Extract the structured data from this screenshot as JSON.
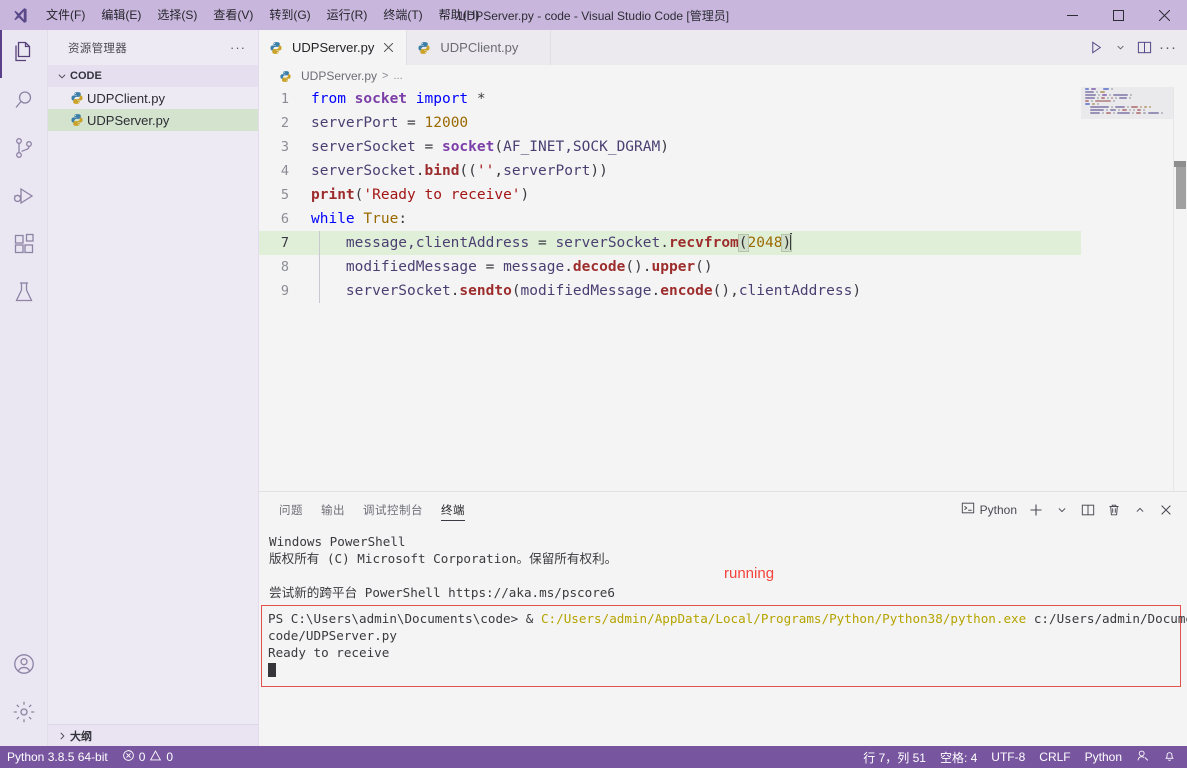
{
  "titlebar": {
    "title": "UDPServer.py - code - Visual Studio Code [管理员]",
    "menus": [
      {
        "label": "文件(F)",
        "name": "menu-file"
      },
      {
        "label": "编辑(E)",
        "name": "menu-edit"
      },
      {
        "label": "选择(S)",
        "name": "menu-selection"
      },
      {
        "label": "查看(V)",
        "name": "menu-view"
      },
      {
        "label": "转到(G)",
        "name": "menu-go"
      },
      {
        "label": "运行(R)",
        "name": "menu-run"
      },
      {
        "label": "终端(T)",
        "name": "menu-terminal"
      },
      {
        "label": "帮助(H)",
        "name": "menu-help"
      }
    ],
    "window_buttons": [
      "minimize",
      "maximize",
      "close"
    ]
  },
  "activitybar": {
    "top": [
      {
        "icon": "files-explorer-icon",
        "active": true
      },
      {
        "icon": "search-icon",
        "active": false
      },
      {
        "icon": "source-control-icon",
        "active": false
      },
      {
        "icon": "run-and-debug-icon",
        "active": false
      },
      {
        "icon": "extensions-icon",
        "active": false
      },
      {
        "icon": "testing-beaker-icon",
        "active": false
      }
    ],
    "bottom": [
      {
        "icon": "account-icon"
      },
      {
        "icon": "gear-icon"
      }
    ]
  },
  "sidebar": {
    "header_title": "资源管理器",
    "more_actions": "···",
    "folder": {
      "label": "CODE",
      "expanded": true
    },
    "files": [
      {
        "label": "UDPClient.py",
        "selected": false
      },
      {
        "label": "UDPServer.py",
        "selected": true
      }
    ],
    "outline_label": "大纲"
  },
  "editor": {
    "tabs": [
      {
        "label": "UDPServer.py",
        "active": true
      },
      {
        "label": "UDPClient.py",
        "active": false
      }
    ],
    "breadcrumb": {
      "file": "UDPServer.py",
      "separator": ">",
      "rest": "..."
    },
    "actions": [
      "run-python-file-icon",
      "chevron-down-icon",
      "split-editor-icon",
      "more-actions-icon"
    ],
    "current_line": 7,
    "lines": [
      {
        "n": 1,
        "tokens": [
          {
            "t": "from ",
            "c": "kw"
          },
          {
            "t": "socket",
            "c": "kwc"
          },
          {
            "t": " import ",
            "c": "kw"
          },
          {
            "t": "*",
            "c": "op"
          }
        ]
      },
      {
        "n": 2,
        "tokens": [
          {
            "t": "serverPort ",
            "c": "var"
          },
          {
            "t": "= ",
            "c": "op"
          },
          {
            "t": "12000",
            "c": "num"
          }
        ]
      },
      {
        "n": 3,
        "tokens": [
          {
            "t": "serverSocket ",
            "c": "var"
          },
          {
            "t": "= ",
            "c": "op"
          },
          {
            "t": "socket",
            "c": "kwc"
          },
          {
            "t": "(",
            "c": "op"
          },
          {
            "t": "AF_INET,SOCK_DGRAM",
            "c": "var"
          },
          {
            "t": ")",
            "c": "op"
          }
        ]
      },
      {
        "n": 4,
        "tokens": [
          {
            "t": "serverSocket",
            "c": "var"
          },
          {
            "t": ".",
            "c": "op"
          },
          {
            "t": "bind",
            "c": "fn"
          },
          {
            "t": "((",
            "c": "op"
          },
          {
            "t": "''",
            "c": "str"
          },
          {
            "t": ",",
            "c": "op"
          },
          {
            "t": "serverPort",
            "c": "var"
          },
          {
            "t": "))",
            "c": "op"
          }
        ]
      },
      {
        "n": 5,
        "tokens": [
          {
            "t": "print",
            "c": "fn"
          },
          {
            "t": "(",
            "c": "op"
          },
          {
            "t": "'Ready to receive'",
            "c": "str"
          },
          {
            "t": ")",
            "c": "op"
          }
        ]
      },
      {
        "n": 6,
        "tokens": [
          {
            "t": "while ",
            "c": "kw"
          },
          {
            "t": "True",
            "c": "num"
          },
          {
            "t": ":",
            "c": "op"
          }
        ]
      },
      {
        "n": 7,
        "indent": true,
        "tokens": [
          {
            "t": "    message,clientAddress ",
            "c": "var"
          },
          {
            "t": "= ",
            "c": "op"
          },
          {
            "t": "serverSocket",
            "c": "var"
          },
          {
            "t": ".",
            "c": "op"
          },
          {
            "t": "recvfrom",
            "c": "fn"
          },
          {
            "t": "(",
            "c": "brk"
          },
          {
            "t": "2048",
            "c": "num"
          },
          {
            "t": ")",
            "c": "brk"
          },
          {
            "t": "|",
            "c": "cursor"
          }
        ]
      },
      {
        "n": 8,
        "indent": true,
        "tokens": [
          {
            "t": "    modifiedMessage ",
            "c": "var"
          },
          {
            "t": "= ",
            "c": "op"
          },
          {
            "t": "message",
            "c": "var"
          },
          {
            "t": ".",
            "c": "op"
          },
          {
            "t": "decode",
            "c": "fn"
          },
          {
            "t": "()",
            "c": "op"
          },
          {
            "t": ".",
            "c": "op"
          },
          {
            "t": "upper",
            "c": "fn"
          },
          {
            "t": "()",
            "c": "op"
          }
        ]
      },
      {
        "n": 9,
        "indent": true,
        "tokens": [
          {
            "t": "    serverSocket",
            "c": "var"
          },
          {
            "t": ".",
            "c": "op"
          },
          {
            "t": "sendto",
            "c": "fn"
          },
          {
            "t": "(",
            "c": "op"
          },
          {
            "t": "modifiedMessage",
            "c": "var"
          },
          {
            "t": ".",
            "c": "op"
          },
          {
            "t": "encode",
            "c": "fn"
          },
          {
            "t": "(),",
            "c": "op"
          },
          {
            "t": "clientAddress",
            "c": "var"
          },
          {
            "t": ")",
            "c": "op"
          }
        ]
      }
    ]
  },
  "panel": {
    "tabs": [
      {
        "label": "问题",
        "active": false
      },
      {
        "label": "输出",
        "active": false
      },
      {
        "label": "调试控制台",
        "active": false
      },
      {
        "label": "终端",
        "active": true
      }
    ],
    "terminal_selector": "Python",
    "actions": [
      "new-terminal-icon",
      "chevron-down-icon",
      "split-terminal-icon",
      "kill-terminal-icon",
      "maximize-panel-icon",
      "close-panel-icon"
    ],
    "terminal": {
      "header_lines": [
        "Windows PowerShell",
        "版权所有 (C) Microsoft Corporation。保留所有权利。",
        "",
        "尝试新的跨平台 PowerShell https://aka.ms/pscore6"
      ],
      "annotation": "running",
      "prompt": "PS C:\\Users\\admin\\Documents\\code> & ",
      "python_path": "C:/Users/admin/AppData/Local/Programs/Python/Python38/python.exe",
      "script_arg": " c:/Users/admin/Documents/",
      "script_wrap": "code/UDPServer.py",
      "output": "Ready to receive"
    }
  },
  "statusbar": {
    "left": [
      {
        "label": "Python 3.8.5 64-bit",
        "name": "status-python-interpreter"
      },
      {
        "label": "0",
        "icon": "error-icon",
        "label2": "0",
        "icon2": "warning-icon",
        "name": "status-problems"
      }
    ],
    "right": [
      {
        "label": "行 7，列 51",
        "name": "status-cursor-position"
      },
      {
        "label": "空格: 4",
        "name": "status-indentation"
      },
      {
        "label": "UTF-8",
        "name": "status-encoding"
      },
      {
        "label": "CRLF",
        "name": "status-eol"
      },
      {
        "label": "Python",
        "name": "status-language-mode"
      }
    ],
    "right_icons": [
      "feedback-smiley-icon",
      "notifications-bell-icon"
    ]
  },
  "colors": {
    "titlebar_bg": "#c8b6dd",
    "statusbar_bg": "#77559f",
    "activitybar_bg": "#ebe7f2",
    "sidebar_bg": "#eeeaf4",
    "editor_bg": "#f4f4f4",
    "selected_file_bg": "#d3e3cd",
    "current_line_bg": "#e0f0d8",
    "annotation_red": "#f4433c",
    "cmdbox_border": "#e0534c",
    "terminal_path_yellow": "#b5a400"
  }
}
